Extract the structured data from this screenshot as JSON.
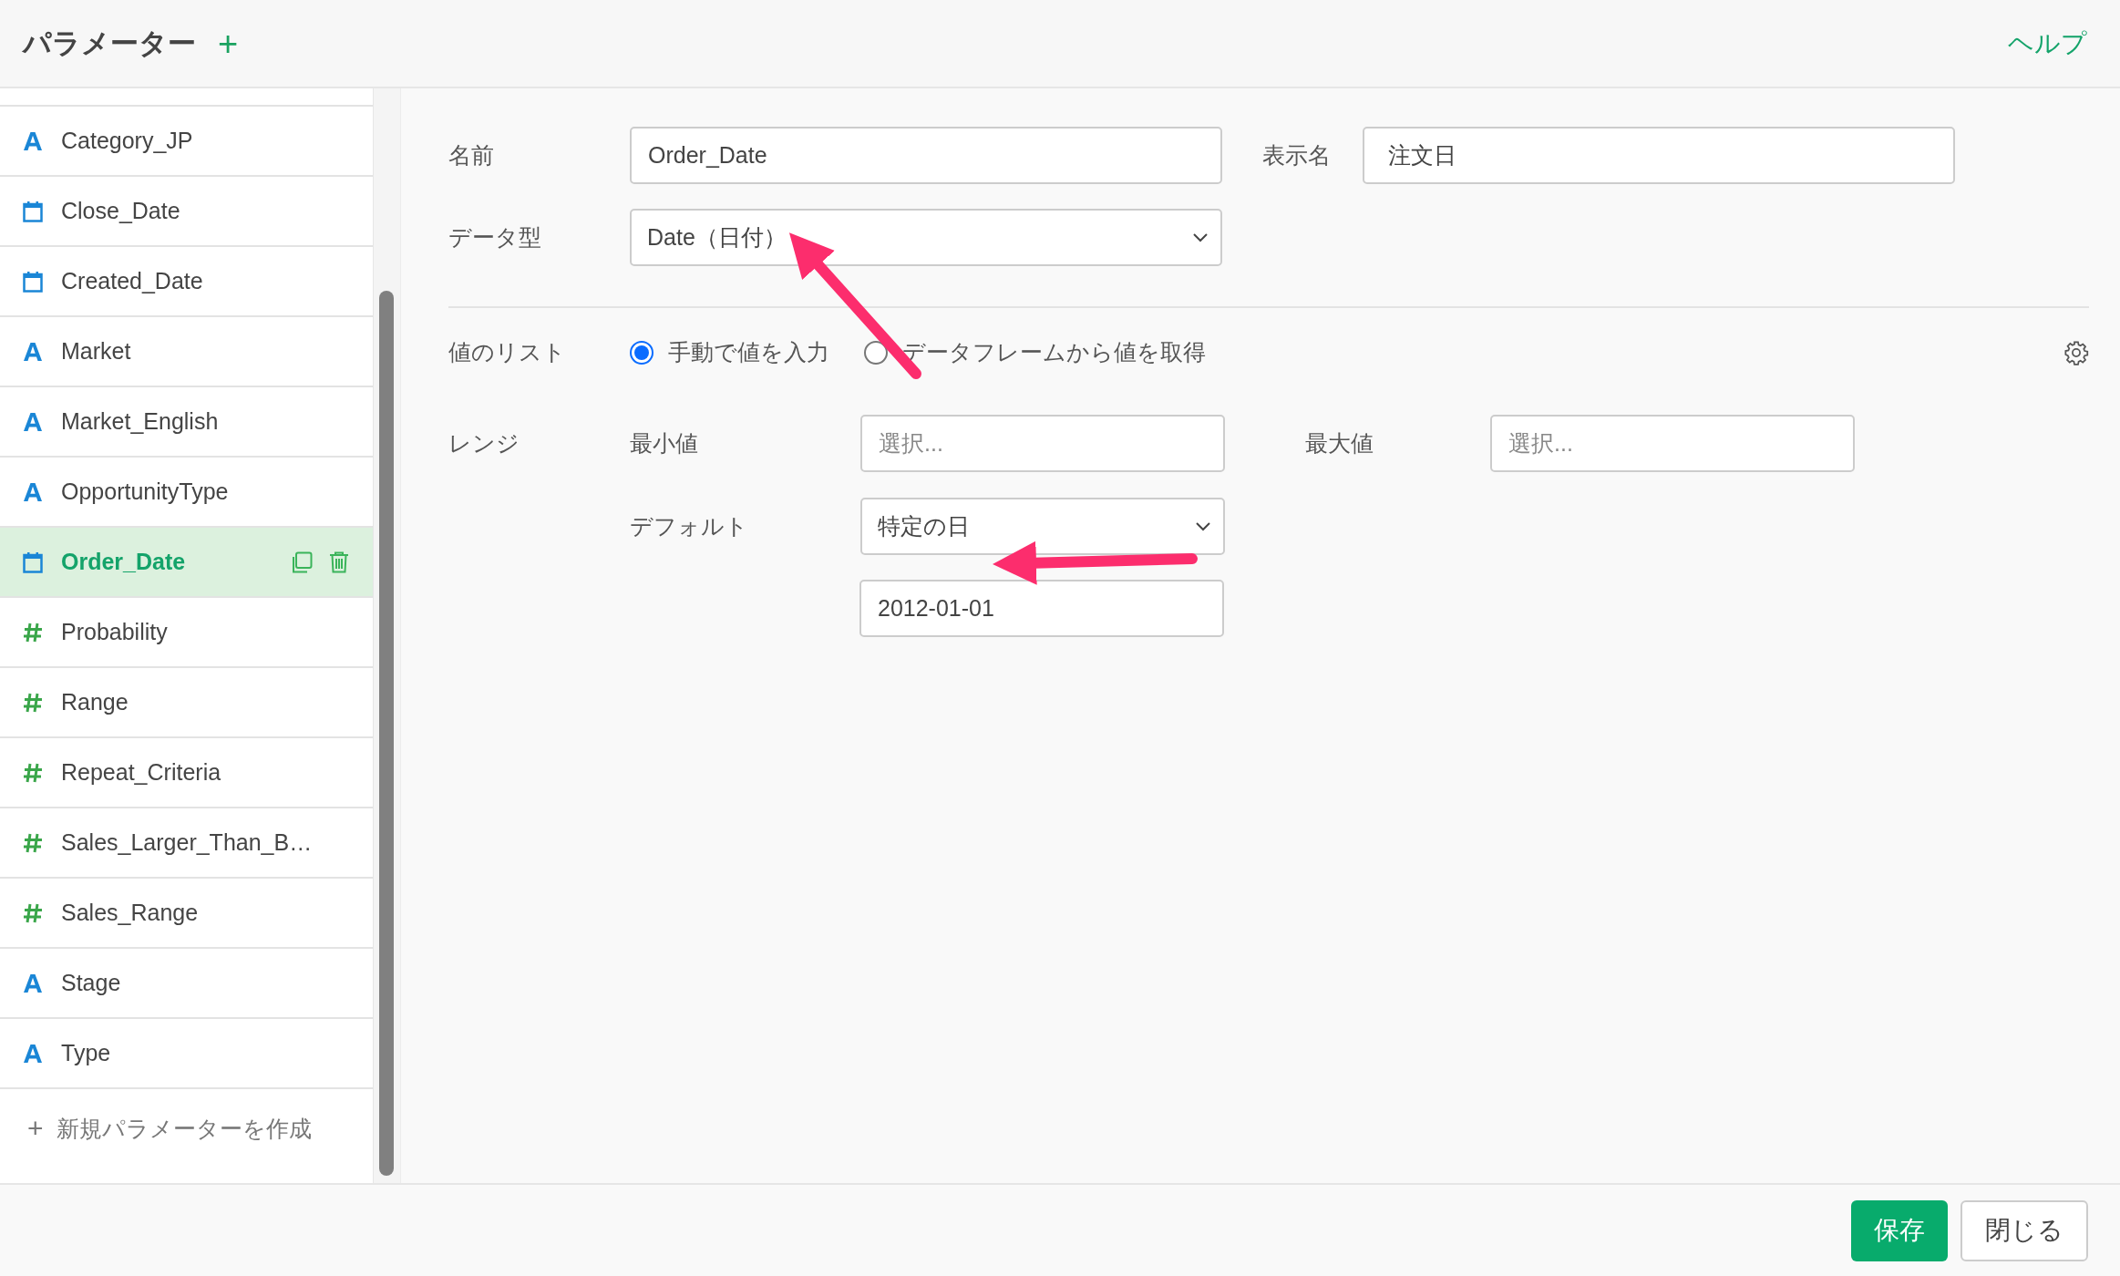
{
  "header": {
    "title": "パラメーター",
    "add_icon": "+",
    "help": "ヘルプ"
  },
  "sidebar": {
    "items": [
      {
        "kind": "text",
        "label": "Category_JP",
        "selected": false
      },
      {
        "kind": "date",
        "label": "Close_Date",
        "selected": false
      },
      {
        "kind": "date",
        "label": "Created_Date",
        "selected": false
      },
      {
        "kind": "text",
        "label": "Market",
        "selected": false
      },
      {
        "kind": "text",
        "label": "Market_English",
        "selected": false
      },
      {
        "kind": "text",
        "label": "OpportunityType",
        "selected": false
      },
      {
        "kind": "date",
        "label": "Order_Date",
        "selected": true
      },
      {
        "kind": "number",
        "label": "Probability",
        "selected": false
      },
      {
        "kind": "number",
        "label": "Range",
        "selected": false
      },
      {
        "kind": "number",
        "label": "Repeat_Criteria",
        "selected": false
      },
      {
        "kind": "number",
        "label": "Sales_Larger_Than_B…",
        "selected": false
      },
      {
        "kind": "number",
        "label": "Sales_Range",
        "selected": false
      },
      {
        "kind": "text",
        "label": "Stage",
        "selected": false
      },
      {
        "kind": "text",
        "label": "Type",
        "selected": false
      }
    ],
    "new_parameter": {
      "icon": "+",
      "label": "新規パラメーターを作成"
    }
  },
  "form": {
    "name_label": "名前",
    "name_value": "Order_Date",
    "display_label": "表示名",
    "display_value": "注文日",
    "type_label": "データ型",
    "type_value": "Date（日付）",
    "values_label": "値のリスト",
    "values_options": [
      {
        "label": "手動で値を入力",
        "selected": true
      },
      {
        "label": "データフレームから値を取得",
        "selected": false
      }
    ],
    "range_label": "レンジ",
    "min_label": "最小値",
    "min_placeholder": "選択...",
    "max_label": "最大値",
    "max_placeholder": "選択...",
    "default_label": "デフォルト",
    "default_value": "特定の日",
    "default_date": "2012-01-01"
  },
  "footer": {
    "buttons": [
      {
        "kind": "primary",
        "label": "保存"
      },
      {
        "kind": "secondary",
        "label": "閉じる"
      }
    ]
  }
}
